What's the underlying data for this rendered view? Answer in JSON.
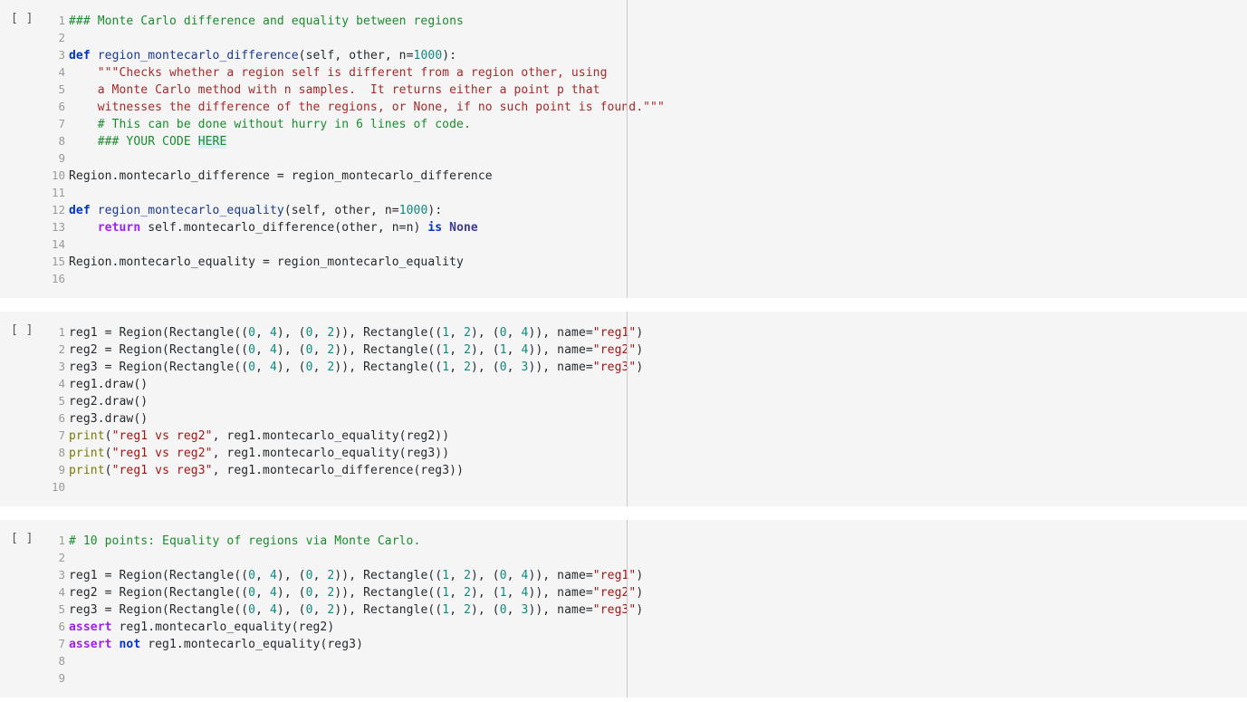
{
  "theme": {
    "page_background": "#ffffff",
    "cell_background": "#f5f5f5",
    "ruler_color": "#c9c9c9",
    "line_number_color": "#9a9a9a",
    "comment_color": "#1a8c2e",
    "keyword_color": "#0033cc",
    "control_keyword_color": "#a020f0",
    "string_color": "#a31515",
    "docstring_color": "#a52a2a",
    "number_color": "#0e8a7e",
    "builtin_color": "#7a7a00",
    "constant_color": "#3a3a9e",
    "highlight_background": "#ddeef7"
  },
  "cells": [
    {
      "prompt": "[ ]",
      "type": "code",
      "lines": [
        {
          "n": "1",
          "tokens": [
            {
              "text": "### Monte Carlo difference and equality between regions",
              "cls": "t-comment"
            }
          ]
        },
        {
          "n": "2",
          "tokens": []
        },
        {
          "n": "3",
          "tokens": [
            {
              "text": "def ",
              "cls": "t-def"
            },
            {
              "text": "region_montecarlo_difference",
              "cls": "t-fname"
            },
            {
              "text": "(",
              "cls": "t-plain"
            },
            {
              "text": "self",
              "cls": "t-param"
            },
            {
              "text": ", ",
              "cls": "t-plain"
            },
            {
              "text": "other",
              "cls": "t-param"
            },
            {
              "text": ", n=",
              "cls": "t-plain"
            },
            {
              "text": "1000",
              "cls": "t-number"
            },
            {
              "text": "):",
              "cls": "t-plain"
            }
          ]
        },
        {
          "n": "4",
          "tokens": [
            {
              "text": "    \"\"\"Checks whether a region self is different from a region other, using",
              "cls": "t-doc"
            }
          ]
        },
        {
          "n": "5",
          "tokens": [
            {
              "text": "    a Monte Carlo method with n samples.  It returns either a point p that",
              "cls": "t-doc"
            }
          ]
        },
        {
          "n": "6",
          "tokens": [
            {
              "text": "    witnesses the difference of the regions, or None, if no such point is found.\"\"\"",
              "cls": "t-doc"
            }
          ]
        },
        {
          "n": "7",
          "tokens": [
            {
              "text": "    # This can be done without hurry in 6 lines of code.",
              "cls": "t-comment"
            }
          ]
        },
        {
          "n": "8",
          "tokens": [
            {
              "text": "    ### YOUR CODE ",
              "cls": "t-comment"
            },
            {
              "text": "HERE",
              "cls": "t-comment t-hl"
            }
          ]
        },
        {
          "n": "9",
          "tokens": []
        },
        {
          "n": "10",
          "tokens": [
            {
              "text": "Region.montecarlo_difference = region_montecarlo_difference",
              "cls": "t-plain"
            }
          ]
        },
        {
          "n": "11",
          "tokens": []
        },
        {
          "n": "12",
          "tokens": [
            {
              "text": "def ",
              "cls": "t-def"
            },
            {
              "text": "region_montecarlo_equality",
              "cls": "t-fname"
            },
            {
              "text": "(",
              "cls": "t-plain"
            },
            {
              "text": "self",
              "cls": "t-param"
            },
            {
              "text": ", ",
              "cls": "t-plain"
            },
            {
              "text": "other",
              "cls": "t-param"
            },
            {
              "text": ", n=",
              "cls": "t-plain"
            },
            {
              "text": "1000",
              "cls": "t-number"
            },
            {
              "text": "):",
              "cls": "t-plain"
            }
          ]
        },
        {
          "n": "13",
          "tokens": [
            {
              "text": "    ",
              "cls": "t-plain"
            },
            {
              "text": "return",
              "cls": "t-kw2"
            },
            {
              "text": " self.montecarlo_difference(other, n=n) ",
              "cls": "t-plain"
            },
            {
              "text": "is",
              "cls": "t-op-kw"
            },
            {
              "text": " ",
              "cls": "t-plain"
            },
            {
              "text": "None",
              "cls": "t-const"
            }
          ]
        },
        {
          "n": "14",
          "tokens": []
        },
        {
          "n": "15",
          "tokens": [
            {
              "text": "Region.montecarlo_equality = region_montecarlo_equality",
              "cls": "t-plain"
            }
          ]
        },
        {
          "n": "16",
          "tokens": []
        }
      ]
    },
    {
      "prompt": "[ ]",
      "type": "code",
      "lines": [
        {
          "n": "1",
          "tokens": [
            {
              "text": "reg1 = Region(Rectangle((",
              "cls": "t-plain"
            },
            {
              "text": "0",
              "cls": "t-number"
            },
            {
              "text": ", ",
              "cls": "t-plain"
            },
            {
              "text": "4",
              "cls": "t-number"
            },
            {
              "text": "), (",
              "cls": "t-plain"
            },
            {
              "text": "0",
              "cls": "t-number"
            },
            {
              "text": ", ",
              "cls": "t-plain"
            },
            {
              "text": "2",
              "cls": "t-number"
            },
            {
              "text": ")), Rectangle((",
              "cls": "t-plain"
            },
            {
              "text": "1",
              "cls": "t-number"
            },
            {
              "text": ", ",
              "cls": "t-plain"
            },
            {
              "text": "2",
              "cls": "t-number"
            },
            {
              "text": "), (",
              "cls": "t-plain"
            },
            {
              "text": "0",
              "cls": "t-number"
            },
            {
              "text": ", ",
              "cls": "t-plain"
            },
            {
              "text": "4",
              "cls": "t-number"
            },
            {
              "text": ")), name=",
              "cls": "t-plain"
            },
            {
              "text": "\"reg1\"",
              "cls": "t-string"
            },
            {
              "text": ")",
              "cls": "t-plain"
            }
          ]
        },
        {
          "n": "2",
          "tokens": [
            {
              "text": "reg2 = Region(Rectangle((",
              "cls": "t-plain"
            },
            {
              "text": "0",
              "cls": "t-number"
            },
            {
              "text": ", ",
              "cls": "t-plain"
            },
            {
              "text": "4",
              "cls": "t-number"
            },
            {
              "text": "), (",
              "cls": "t-plain"
            },
            {
              "text": "0",
              "cls": "t-number"
            },
            {
              "text": ", ",
              "cls": "t-plain"
            },
            {
              "text": "2",
              "cls": "t-number"
            },
            {
              "text": ")), Rectangle((",
              "cls": "t-plain"
            },
            {
              "text": "1",
              "cls": "t-number"
            },
            {
              "text": ", ",
              "cls": "t-plain"
            },
            {
              "text": "2",
              "cls": "t-number"
            },
            {
              "text": "), (",
              "cls": "t-plain"
            },
            {
              "text": "1",
              "cls": "t-number"
            },
            {
              "text": ", ",
              "cls": "t-plain"
            },
            {
              "text": "4",
              "cls": "t-number"
            },
            {
              "text": ")), name=",
              "cls": "t-plain"
            },
            {
              "text": "\"reg2\"",
              "cls": "t-string"
            },
            {
              "text": ")",
              "cls": "t-plain"
            }
          ]
        },
        {
          "n": "3",
          "tokens": [
            {
              "text": "reg3 = Region(Rectangle((",
              "cls": "t-plain"
            },
            {
              "text": "0",
              "cls": "t-number"
            },
            {
              "text": ", ",
              "cls": "t-plain"
            },
            {
              "text": "4",
              "cls": "t-number"
            },
            {
              "text": "), (",
              "cls": "t-plain"
            },
            {
              "text": "0",
              "cls": "t-number"
            },
            {
              "text": ", ",
              "cls": "t-plain"
            },
            {
              "text": "2",
              "cls": "t-number"
            },
            {
              "text": ")), Rectangle((",
              "cls": "t-plain"
            },
            {
              "text": "1",
              "cls": "t-number"
            },
            {
              "text": ", ",
              "cls": "t-plain"
            },
            {
              "text": "2",
              "cls": "t-number"
            },
            {
              "text": "), (",
              "cls": "t-plain"
            },
            {
              "text": "0",
              "cls": "t-number"
            },
            {
              "text": ", ",
              "cls": "t-plain"
            },
            {
              "text": "3",
              "cls": "t-number"
            },
            {
              "text": ")), name=",
              "cls": "t-plain"
            },
            {
              "text": "\"reg3\"",
              "cls": "t-string"
            },
            {
              "text": ")",
              "cls": "t-plain"
            }
          ]
        },
        {
          "n": "4",
          "tokens": [
            {
              "text": "reg1.draw()",
              "cls": "t-plain"
            }
          ]
        },
        {
          "n": "5",
          "tokens": [
            {
              "text": "reg2.draw()",
              "cls": "t-plain"
            }
          ]
        },
        {
          "n": "6",
          "tokens": [
            {
              "text": "reg3.draw()",
              "cls": "t-plain"
            }
          ]
        },
        {
          "n": "7",
          "tokens": [
            {
              "text": "print",
              "cls": "t-builtin"
            },
            {
              "text": "(",
              "cls": "t-plain"
            },
            {
              "text": "\"reg1 vs reg2\"",
              "cls": "t-string"
            },
            {
              "text": ", reg1.montecarlo_equality(reg2))",
              "cls": "t-plain"
            }
          ]
        },
        {
          "n": "8",
          "tokens": [
            {
              "text": "print",
              "cls": "t-builtin"
            },
            {
              "text": "(",
              "cls": "t-plain"
            },
            {
              "text": "\"reg1 vs reg2\"",
              "cls": "t-string"
            },
            {
              "text": ", reg1.montecarlo_equality(reg3))",
              "cls": "t-plain"
            }
          ]
        },
        {
          "n": "9",
          "tokens": [
            {
              "text": "print",
              "cls": "t-builtin"
            },
            {
              "text": "(",
              "cls": "t-plain"
            },
            {
              "text": "\"reg1 vs reg3\"",
              "cls": "t-string"
            },
            {
              "text": ", reg1.montecarlo_difference(reg3))",
              "cls": "t-plain"
            }
          ]
        },
        {
          "n": "10",
          "tokens": []
        }
      ]
    },
    {
      "prompt": "[ ]",
      "type": "code",
      "lines": [
        {
          "n": "1",
          "tokens": [
            {
              "text": "# 10 points: Equality of regions via Monte Carlo.",
              "cls": "t-comment"
            }
          ]
        },
        {
          "n": "2",
          "tokens": []
        },
        {
          "n": "3",
          "tokens": [
            {
              "text": "reg1 = Region(Rectangle((",
              "cls": "t-plain"
            },
            {
              "text": "0",
              "cls": "t-number"
            },
            {
              "text": ", ",
              "cls": "t-plain"
            },
            {
              "text": "4",
              "cls": "t-number"
            },
            {
              "text": "), (",
              "cls": "t-plain"
            },
            {
              "text": "0",
              "cls": "t-number"
            },
            {
              "text": ", ",
              "cls": "t-plain"
            },
            {
              "text": "2",
              "cls": "t-number"
            },
            {
              "text": ")), Rectangle((",
              "cls": "t-plain"
            },
            {
              "text": "1",
              "cls": "t-number"
            },
            {
              "text": ", ",
              "cls": "t-plain"
            },
            {
              "text": "2",
              "cls": "t-number"
            },
            {
              "text": "), (",
              "cls": "t-plain"
            },
            {
              "text": "0",
              "cls": "t-number"
            },
            {
              "text": ", ",
              "cls": "t-plain"
            },
            {
              "text": "4",
              "cls": "t-number"
            },
            {
              "text": ")), name=",
              "cls": "t-plain"
            },
            {
              "text": "\"reg1\"",
              "cls": "t-string"
            },
            {
              "text": ")",
              "cls": "t-plain"
            }
          ]
        },
        {
          "n": "4",
          "tokens": [
            {
              "text": "reg2 = Region(Rectangle((",
              "cls": "t-plain"
            },
            {
              "text": "0",
              "cls": "t-number"
            },
            {
              "text": ", ",
              "cls": "t-plain"
            },
            {
              "text": "4",
              "cls": "t-number"
            },
            {
              "text": "), (",
              "cls": "t-plain"
            },
            {
              "text": "0",
              "cls": "t-number"
            },
            {
              "text": ", ",
              "cls": "t-plain"
            },
            {
              "text": "2",
              "cls": "t-number"
            },
            {
              "text": ")), Rectangle((",
              "cls": "t-plain"
            },
            {
              "text": "1",
              "cls": "t-number"
            },
            {
              "text": ", ",
              "cls": "t-plain"
            },
            {
              "text": "2",
              "cls": "t-number"
            },
            {
              "text": "), (",
              "cls": "t-plain"
            },
            {
              "text": "1",
              "cls": "t-number"
            },
            {
              "text": ", ",
              "cls": "t-plain"
            },
            {
              "text": "4",
              "cls": "t-number"
            },
            {
              "text": ")), name=",
              "cls": "t-plain"
            },
            {
              "text": "\"reg2\"",
              "cls": "t-string"
            },
            {
              "text": ")",
              "cls": "t-plain"
            }
          ]
        },
        {
          "n": "5",
          "tokens": [
            {
              "text": "reg3 = Region(Rectangle((",
              "cls": "t-plain"
            },
            {
              "text": "0",
              "cls": "t-number"
            },
            {
              "text": ", ",
              "cls": "t-plain"
            },
            {
              "text": "4",
              "cls": "t-number"
            },
            {
              "text": "), (",
              "cls": "t-plain"
            },
            {
              "text": "0",
              "cls": "t-number"
            },
            {
              "text": ", ",
              "cls": "t-plain"
            },
            {
              "text": "2",
              "cls": "t-number"
            },
            {
              "text": ")), Rectangle((",
              "cls": "t-plain"
            },
            {
              "text": "1",
              "cls": "t-number"
            },
            {
              "text": ", ",
              "cls": "t-plain"
            },
            {
              "text": "2",
              "cls": "t-number"
            },
            {
              "text": "), (",
              "cls": "t-plain"
            },
            {
              "text": "0",
              "cls": "t-number"
            },
            {
              "text": ", ",
              "cls": "t-plain"
            },
            {
              "text": "3",
              "cls": "t-number"
            },
            {
              "text": ")), name=",
              "cls": "t-plain"
            },
            {
              "text": "\"reg3\"",
              "cls": "t-string"
            },
            {
              "text": ")",
              "cls": "t-plain"
            }
          ]
        },
        {
          "n": "6",
          "tokens": [
            {
              "text": "assert",
              "cls": "t-kw2"
            },
            {
              "text": " reg1.montecarlo_equality(reg2)",
              "cls": "t-plain"
            }
          ]
        },
        {
          "n": "7",
          "tokens": [
            {
              "text": "assert",
              "cls": "t-kw2"
            },
            {
              "text": " ",
              "cls": "t-plain"
            },
            {
              "text": "not",
              "cls": "t-op-kw"
            },
            {
              "text": " reg1.montecarlo_equality(reg3)",
              "cls": "t-plain"
            }
          ]
        },
        {
          "n": "8",
          "tokens": []
        },
        {
          "n": "9",
          "tokens": []
        }
      ]
    }
  ]
}
